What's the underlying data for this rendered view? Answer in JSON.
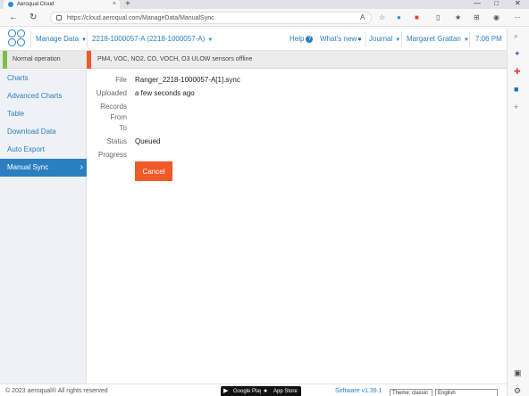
{
  "browser": {
    "tab_title": "Aeroqual Cloud",
    "tab_close": "×",
    "new_tab": "+",
    "win_minimize": "—",
    "win_maximize": "□",
    "win_close": "✕",
    "url": "https://cloud.aeroqual.com/ManageData/ManualSync",
    "back": "←",
    "refresh": "↻"
  },
  "header": {
    "manage_data": "Manage Data",
    "device": "2218-1000057-A (2218-1000057-A)",
    "help": "Help",
    "whats_new": "What's new",
    "journal": "Journal",
    "user": "Margaret Grattan",
    "time": "7:06 PM"
  },
  "status": {
    "left": "Normal operation",
    "right": "PM4, VOC, NO2, CO, VOCH, O3 ULOW sensors offline"
  },
  "sidebar": {
    "items": [
      {
        "label": "Charts"
      },
      {
        "label": "Advanced Charts"
      },
      {
        "label": "Table"
      },
      {
        "label": "Download Data"
      },
      {
        "label": "Auto Export"
      },
      {
        "label": "Manual Sync"
      }
    ]
  },
  "sync": {
    "file_label": "File",
    "file_value": "Ranger_2218-1000057-A[1].sync",
    "uploaded_label": "Uploaded",
    "uploaded_value": "a few seconds ago",
    "records_label": "Records",
    "from_label": "From",
    "to_label": "To",
    "status_label": "Status",
    "status_value": "Queued",
    "progress_label": "Progress",
    "cancel_label": "Cancel"
  },
  "footer": {
    "copyright": "© 2023 aeroqual® All rights reserved",
    "google_play": "Google Play",
    "app_store": "App Store",
    "software": "Software v1.39.1",
    "theme": "Theme: classic",
    "language": "English"
  },
  "colors": {
    "accent": "#2a7fc0",
    "alert": "#f05a28",
    "ok": "#7dc142"
  }
}
